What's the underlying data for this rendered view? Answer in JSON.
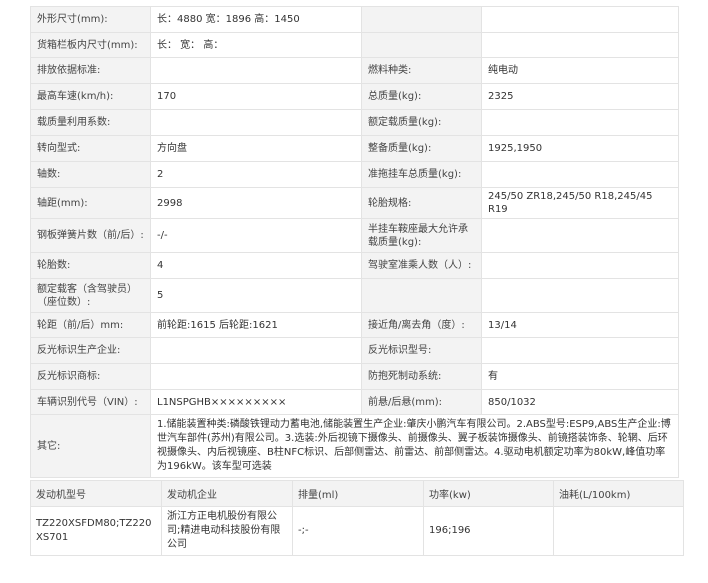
{
  "spec_rows": [
    {
      "l1": "外形尺寸(mm):",
      "v1": "长：4880 宽：1896 高：1450",
      "l2": "",
      "v2": ""
    },
    {
      "l1": "货箱栏板内尺寸(mm):",
      "v1": "长： 宽： 高：",
      "l2": "",
      "v2": ""
    },
    {
      "l1": "排放依据标准:",
      "v1": "",
      "l2": "燃料种类:",
      "v2": "纯电动"
    },
    {
      "l1": "最高车速(km/h):",
      "v1": "170",
      "l2": "总质量(kg):",
      "v2": "2325"
    },
    {
      "l1": "载质量利用系数:",
      "v1": "",
      "l2": "额定载质量(kg):",
      "v2": ""
    },
    {
      "l1": "转向型式:",
      "v1": "方向盘",
      "l2": "整备质量(kg):",
      "v2": "1925,1950"
    },
    {
      "l1": "轴数:",
      "v1": "2",
      "l2": "准拖挂车总质量(kg):",
      "v2": ""
    },
    {
      "l1": "轴距(mm):",
      "v1": "2998",
      "l2": "轮胎规格:",
      "v2": "245/50 ZR18,245/50 R18,245/45 R19"
    },
    {
      "l1": "钢板弹簧片数（前/后）:",
      "v1": "-/-",
      "l2": "半挂车鞍座最大允许承载质量(kg):",
      "v2": ""
    },
    {
      "l1": "轮胎数:",
      "v1": "4",
      "l2": "驾驶室准乘人数（人）:",
      "v2": ""
    },
    {
      "l1": "额定载客（含驾驶员）（座位数）:",
      "v1": "5",
      "l2": "",
      "v2": ""
    },
    {
      "l1": "轮距（前/后）mm:",
      "v1": "前轮距:1615 后轮距:1621",
      "l2": "接近角/离去角（度）:",
      "v2": "13/14"
    },
    {
      "l1": "反光标识生产企业:",
      "v1": "",
      "l2": "反光标识型号:",
      "v2": ""
    },
    {
      "l1": "反光标识商标:",
      "v1": "",
      "l2": "防抱死制动系统:",
      "v2": "有"
    },
    {
      "l1": "车辆识别代号（VIN）:",
      "v1": "L1NSPGHB×××××××××",
      "l2": "前悬/后悬(mm):",
      "v2": "850/1032"
    }
  ],
  "other": {
    "label": "其它:",
    "text": "1.储能装置种类:磷酸铁锂动力蓄电池,储能装置生产企业:肇庆小鹏汽车有限公司。2.ABS型号:ESP9,ABS生产企业:博世汽车部件(苏州)有限公司。3.选装:外后视镜下摄像头、前摄像头、翼子板装饰摄像头、前镜搭装饰条、轮辋、后环视摄像头、内后视镜座、B柱NFC标识、后部侧雷达、前雷达、前部侧雷达。4.驱动电机额定功率为80kW,峰值功率为196kW。该车型可选装"
  },
  "engine": {
    "headers": [
      "发动机型号",
      "发动机企业",
      "排量(ml)",
      "功率(kw)",
      "油耗(L/100km)"
    ],
    "row": [
      "TZ220XSFDM80;TZ220XS701",
      "浙江方正电机股份有限公司;精进电动科技股份有限公司",
      "-;-",
      "196;196",
      ""
    ]
  }
}
